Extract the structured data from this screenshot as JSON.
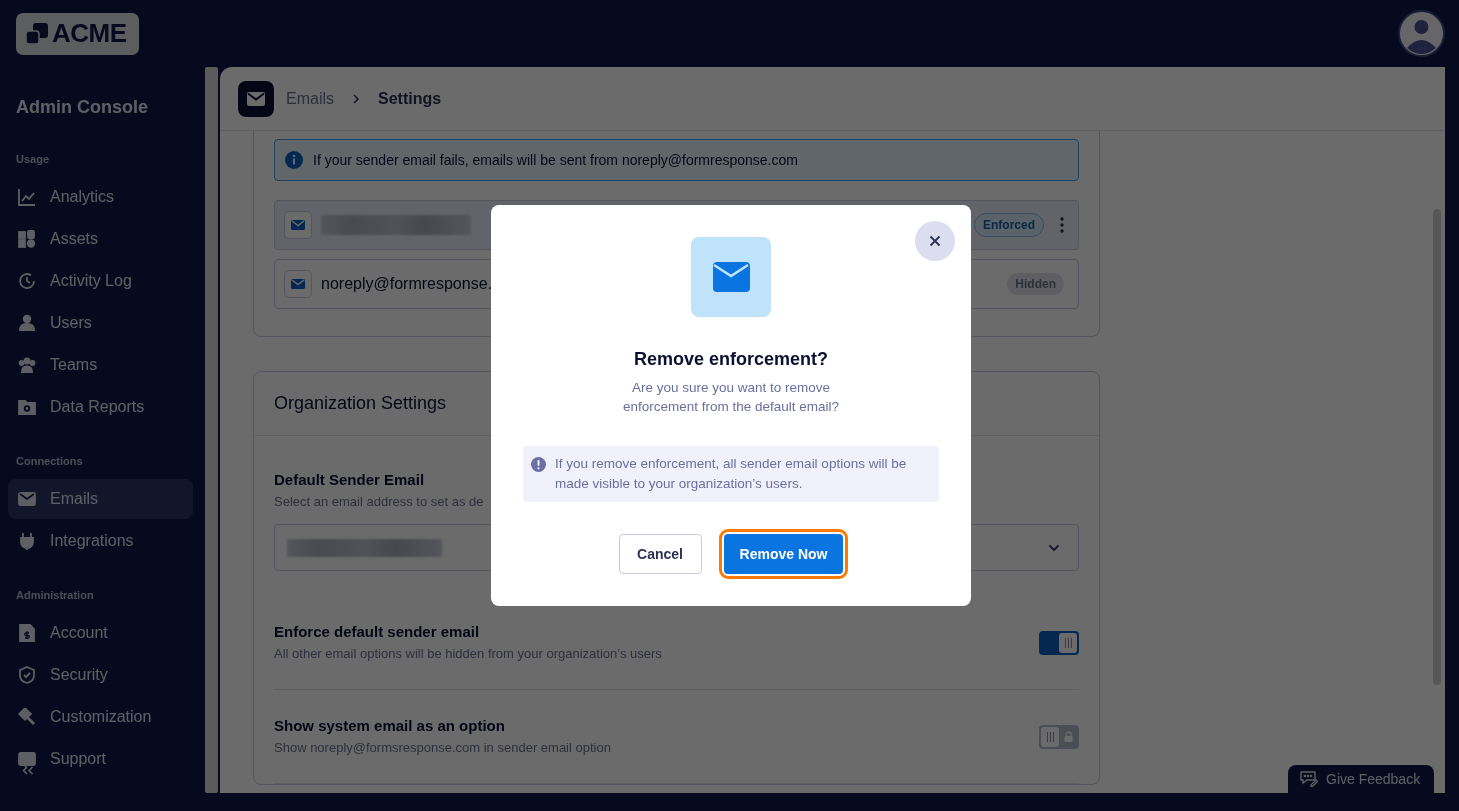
{
  "brand": {
    "logo_text": "ACME"
  },
  "sidebar": {
    "title": "Admin Console",
    "sections": [
      {
        "heading": "Usage",
        "items": [
          {
            "label": "Analytics",
            "selected": false
          },
          {
            "label": "Assets",
            "selected": false
          },
          {
            "label": "Activity Log",
            "selected": false
          },
          {
            "label": "Users",
            "selected": false
          },
          {
            "label": "Teams",
            "selected": false
          },
          {
            "label": "Data Reports",
            "selected": false
          }
        ]
      },
      {
        "heading": "Connections",
        "items": [
          {
            "label": "Emails",
            "selected": true
          },
          {
            "label": "Integrations",
            "selected": false
          }
        ]
      },
      {
        "heading": "Administration",
        "items": [
          {
            "label": "Account",
            "selected": false
          },
          {
            "label": "Security",
            "selected": false
          },
          {
            "label": "Customization",
            "selected": false
          },
          {
            "label": "Support",
            "selected": false
          }
        ]
      }
    ]
  },
  "breadcrumb": [
    "Emails",
    "Settings"
  ],
  "info_banner": "If your sender email fails, emails will be sent from noreply@formresponse.com",
  "sender_emails": [
    {
      "kind": "redacted",
      "selected": true,
      "badge": "Enforced",
      "has_menu": true
    },
    {
      "kind": "address",
      "selected": false,
      "address": "noreply@formresponse.",
      "badge": "Hidden",
      "has_menu": false
    }
  ],
  "organization_settings": {
    "title": "Organization Settings",
    "default_sender": {
      "label": "Default Sender Email",
      "description": "Select an email address to set as de"
    },
    "toggles": [
      {
        "title": "Enforce default sender email",
        "description": "All other email options will be hidden from your organization’s users",
        "on": true,
        "locked": false
      },
      {
        "title": "Show system email as an option",
        "description": "Show noreply@formsresponse.com in sender email option",
        "on": false,
        "locked": true
      }
    ]
  },
  "feedback_button": "Give Feedback",
  "modal": {
    "title": "Remove enforcement?",
    "message": "Are you sure you want to remove enforcement from the default email?",
    "warning": "If you remove enforcement, all sender email options will be made visible to your organization’s users.",
    "buttons": [
      {
        "label": "Cancel",
        "kind": "secondary",
        "focused": false
      },
      {
        "label": "Remove Now",
        "kind": "primary",
        "focused": true
      }
    ]
  }
}
